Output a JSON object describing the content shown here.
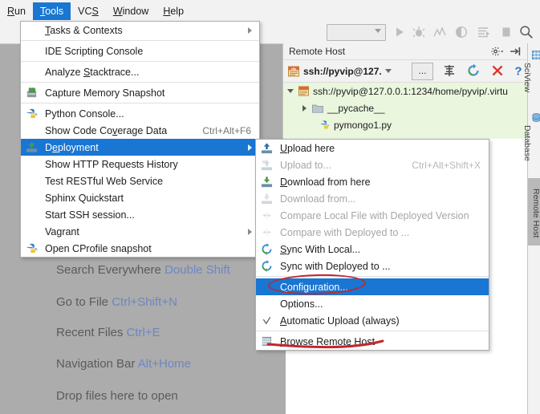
{
  "menubar": {
    "items": [
      {
        "label": "Run",
        "mnemonic": "R",
        "active": false
      },
      {
        "label": "Tools",
        "mnemonic": "T",
        "active": true
      },
      {
        "label": "VCS",
        "mnemonic": "S",
        "active": false
      },
      {
        "label": "Window",
        "mnemonic": "W",
        "active": false
      },
      {
        "label": "Help",
        "mnemonic": "H",
        "active": false
      }
    ]
  },
  "toolbar": {
    "run_config_value": "",
    "icons": [
      {
        "name": "run-icon",
        "label": "Run"
      },
      {
        "name": "debug-icon",
        "label": "Debug"
      },
      {
        "name": "profile-icon",
        "label": "Profile"
      },
      {
        "name": "coverage-icon",
        "label": "Run with Coverage"
      },
      {
        "name": "run-dashboard-icon",
        "label": "Run Dashboard"
      },
      {
        "name": "stop-icon",
        "label": "Stop"
      },
      {
        "name": "search-icon",
        "label": "Search Everywhere"
      }
    ]
  },
  "editor_hints": [
    {
      "text": "Search Everywhere",
      "shortcut": "Double Shift"
    },
    {
      "text": "Go to File",
      "shortcut": "Ctrl+Shift+N"
    },
    {
      "text": "Recent Files",
      "shortcut": "Ctrl+E"
    },
    {
      "text": "Navigation Bar",
      "shortcut": "Alt+Home"
    },
    {
      "text": "Drop files here to open",
      "shortcut": ""
    }
  ],
  "remote_host": {
    "title": "Remote Host",
    "gear_icon": "gear-icon",
    "hide_icon": "hide-panel-icon",
    "server_combo_value": "ssh://pyvip@127.",
    "ellipsis_label": "...",
    "buttons": [
      {
        "name": "sync-browsers-icon",
        "label": "Sync Browsers"
      },
      {
        "name": "refresh-icon",
        "label": "Refresh"
      },
      {
        "name": "close-icon",
        "label": "Close"
      },
      {
        "name": "help-icon",
        "label": "Help"
      }
    ],
    "tree": [
      {
        "label": "ssh://pyvip@127.0.0.1:1234/home/pyvip/.virtu",
        "icon": "sftp-icon",
        "expanded": true,
        "depth": 0
      },
      {
        "label": "__pycache__",
        "icon": "folder-icon",
        "expanded": false,
        "depth": 1
      },
      {
        "label": "pymongo1.py",
        "icon": "python-file-icon",
        "expanded": null,
        "depth": 1
      }
    ]
  },
  "right_tabs": [
    {
      "label": "SciView",
      "icon": "sciview-icon",
      "selected": false
    },
    {
      "label": "Database",
      "icon": "database-icon",
      "selected": false
    },
    {
      "label": "Remote Host",
      "icon": "",
      "selected": true
    }
  ],
  "tools_menu": {
    "items": [
      {
        "label": "Tasks & Contexts",
        "mnemonic": "T",
        "icon": "",
        "accel": "",
        "submenu": true,
        "disabled": false,
        "selected": false,
        "sep_after": true
      },
      {
        "label": "IDE Scripting Console",
        "mnemonic": "",
        "icon": "",
        "accel": "",
        "submenu": false,
        "disabled": false,
        "selected": false,
        "sep_after": true
      },
      {
        "label": "Analyze Stacktrace...",
        "mnemonic": "S",
        "icon": "",
        "accel": "",
        "submenu": false,
        "disabled": false,
        "selected": false,
        "sep_after": true
      },
      {
        "label": "Capture Memory Snapshot",
        "mnemonic": "",
        "icon": "memory-snapshot-icon",
        "accel": "",
        "submenu": false,
        "disabled": false,
        "selected": false,
        "sep_after": true
      },
      {
        "label": "Python Console...",
        "mnemonic": "",
        "icon": "python-icon",
        "accel": "",
        "submenu": false,
        "disabled": false,
        "selected": false,
        "sep_after": false
      },
      {
        "label": "Show Code Coverage Data",
        "mnemonic": "v",
        "icon": "",
        "accel": "Ctrl+Alt+F6",
        "submenu": false,
        "disabled": false,
        "selected": false,
        "sep_after": false
      },
      {
        "label": "Deployment",
        "mnemonic": "e",
        "icon": "deployment-icon",
        "accel": "",
        "submenu": true,
        "disabled": false,
        "selected": true,
        "sep_after": false
      },
      {
        "label": "Show HTTP Requests History",
        "mnemonic": "",
        "icon": "",
        "accel": "",
        "submenu": false,
        "disabled": false,
        "selected": false,
        "sep_after": false
      },
      {
        "label": "Test RESTful Web Service",
        "mnemonic": "",
        "icon": "",
        "accel": "",
        "submenu": false,
        "disabled": false,
        "selected": false,
        "sep_after": false
      },
      {
        "label": "Sphinx Quickstart",
        "mnemonic": "",
        "icon": "",
        "accel": "",
        "submenu": false,
        "disabled": false,
        "selected": false,
        "sep_after": false
      },
      {
        "label": "Start SSH session...",
        "mnemonic": "",
        "icon": "",
        "accel": "",
        "submenu": false,
        "disabled": false,
        "selected": false,
        "sep_after": false
      },
      {
        "label": "Vagrant",
        "mnemonic": "",
        "icon": "",
        "accel": "",
        "submenu": true,
        "disabled": false,
        "selected": false,
        "sep_after": false
      },
      {
        "label": "Open CProfile snapshot",
        "mnemonic": "",
        "icon": "cprofile-icon",
        "accel": "",
        "submenu": false,
        "disabled": false,
        "selected": false,
        "sep_after": false
      }
    ]
  },
  "deployment_menu": {
    "items": [
      {
        "label": "Upload here",
        "mnemonic": "U",
        "icon": "upload-icon",
        "accel": "",
        "disabled": false,
        "selected": false,
        "sep_after": false
      },
      {
        "label": "Upload to...",
        "mnemonic": "",
        "icon": "upload-to-icon",
        "accel": "Ctrl+Alt+Shift+X",
        "disabled": true,
        "selected": false,
        "sep_after": false
      },
      {
        "label": "Download from here",
        "mnemonic": "D",
        "icon": "download-icon",
        "accel": "",
        "disabled": false,
        "selected": false,
        "sep_after": false
      },
      {
        "label": "Download from...",
        "mnemonic": "",
        "icon": "download-from-icon",
        "accel": "",
        "disabled": true,
        "selected": false,
        "sep_after": false
      },
      {
        "label": "Compare Local File with Deployed Version",
        "mnemonic": "",
        "icon": "compare-icon",
        "accel": "",
        "disabled": true,
        "selected": false,
        "sep_after": false
      },
      {
        "label": "Compare with Deployed to ...",
        "mnemonic": "",
        "icon": "compare-icon",
        "accel": "",
        "disabled": true,
        "selected": false,
        "sep_after": false
      },
      {
        "label": "Sync With Local...",
        "mnemonic": "S",
        "icon": "sync-icon",
        "accel": "",
        "disabled": false,
        "selected": false,
        "sep_after": false
      },
      {
        "label": "Sync with Deployed to ...",
        "mnemonic": "",
        "icon": "sync-icon",
        "accel": "",
        "disabled": false,
        "selected": false,
        "sep_after": true
      },
      {
        "label": "Configuration...",
        "mnemonic": "C",
        "icon": "",
        "accel": "",
        "disabled": false,
        "selected": true,
        "sep_after": false
      },
      {
        "label": "Options...",
        "mnemonic": "",
        "icon": "",
        "accel": "",
        "disabled": false,
        "selected": false,
        "sep_after": false
      },
      {
        "label": "Automatic Upload (always)",
        "mnemonic": "A",
        "icon": "check-icon",
        "accel": "",
        "disabled": false,
        "selected": false,
        "sep_after": true
      },
      {
        "label": "Browse Remote Host",
        "mnemonic": "B",
        "icon": "browse-remote-icon",
        "accel": "",
        "disabled": false,
        "selected": false,
        "sep_after": false
      }
    ]
  },
  "annotations": [
    {
      "name": "ellipse-configuration",
      "shape": "ellipse",
      "color": "#c0282d",
      "target": "Configuration..."
    },
    {
      "name": "underline-browse-remote-host",
      "shape": "underline",
      "color": "#c0282d",
      "target": "Browse Remote Host"
    }
  ],
  "colors": {
    "accent_selection": "#1976d2",
    "annotation_red": "#c0282d",
    "editor_bg": "#acacac",
    "tree_bg": "#eaf6de",
    "hint_key": "#6d86c4"
  }
}
